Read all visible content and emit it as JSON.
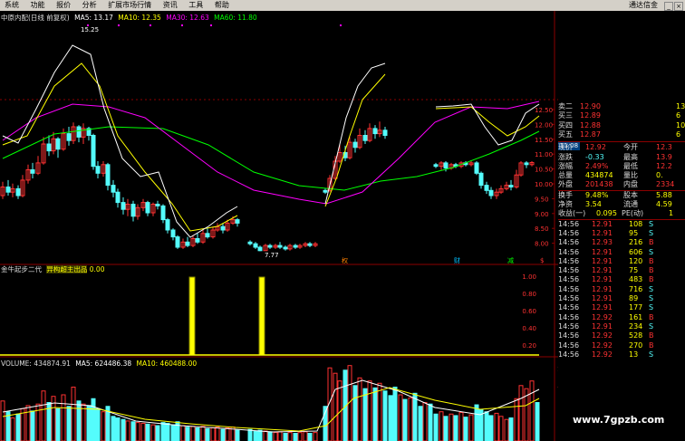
{
  "menu": {
    "items": [
      "系统",
      "功能",
      "报价",
      "分析",
      "扩展市场行情",
      "资讯",
      "工具",
      "帮助"
    ],
    "app_title": "通达信金"
  },
  "main_legend": {
    "stock": "中原内配(日线 前复权)",
    "ma5": "MA5: 13.17",
    "ma10": "MA10: 12.35",
    "ma30": "MA30: 12.63",
    "ma60": "MA60: 11.80"
  },
  "annotations": {
    "high_label": "15.25",
    "low_label": "7.77",
    "current_price_tag": "11.08"
  },
  "event_markers": [
    "权",
    "财",
    "减",
    "$"
  ],
  "price_axis": [
    "12.50",
    "12.00",
    "11.50",
    "11.00",
    "10.50",
    "10.00",
    "9.50",
    "9.00",
    "8.50",
    "8.00"
  ],
  "indicator": {
    "title": "金牛起步二代",
    "signal_label": "异构超主出品",
    "value": "0.00",
    "axis": [
      "1.00",
      "0.80",
      "0.60",
      "0.40",
      "0.20"
    ]
  },
  "volume": {
    "vol": "VOLUME: 434874.91",
    "ma5": "MA5: 624486.38",
    "ma10": "MA10: 460488.00",
    "axis": [
      "10000",
      "7500"
    ]
  },
  "quote_panel": {
    "asks": [
      {
        "label": "卖二",
        "price": "12.90",
        "vol": "13"
      },
      {
        "label": "买三",
        "price": "12.89",
        "vol": "6"
      },
      {
        "label": "买四",
        "price": "12.88",
        "vol": "10"
      },
      {
        "label": "买五",
        "price": "12.87",
        "vol": "6"
      }
    ],
    "stats": [
      {
        "l1": "现价",
        "v1": "12.92",
        "l2": "今开",
        "v2": "12.3"
      },
      {
        "l1": "涨跌",
        "v1": "-0.33",
        "l2": "最高",
        "v2": "13.9"
      },
      {
        "l1": "涨幅",
        "v1": "2.49%",
        "l2": "最低",
        "v2": "12.2"
      },
      {
        "l1": "总量",
        "v1": "434874",
        "l2": "量比",
        "v2": "0."
      },
      {
        "l1": "外盘",
        "v1": "201438",
        "l2": "内盘",
        "v2": "2334"
      },
      {
        "l1": "换手",
        "v1": "9.48%",
        "l2": "股本",
        "v2": "5.88"
      },
      {
        "l1": "净资",
        "v1": "3.54",
        "l2": "流通",
        "v2": "4.59"
      },
      {
        "l1": "收益(一)",
        "v1": "0.095",
        "l2": "PE(动)",
        "v2": "1"
      }
    ],
    "ticks": [
      {
        "t": "14:56",
        "p": "12.91",
        "v": "108",
        "s": "S"
      },
      {
        "t": "14:56",
        "p": "12.91",
        "v": "95",
        "s": "S"
      },
      {
        "t": "14:56",
        "p": "12.93",
        "v": "216",
        "s": "B"
      },
      {
        "t": "14:56",
        "p": "12.91",
        "v": "606",
        "s": "S"
      },
      {
        "t": "14:56",
        "p": "12.91",
        "v": "120",
        "s": "B"
      },
      {
        "t": "14:56",
        "p": "12.91",
        "v": "75",
        "s": "B"
      },
      {
        "t": "14:56",
        "p": "12.91",
        "v": "483",
        "s": "B"
      },
      {
        "t": "14:56",
        "p": "12.91",
        "v": "716",
        "s": "S"
      },
      {
        "t": "14:56",
        "p": "12.91",
        "v": "89",
        "s": "S"
      },
      {
        "t": "14:56",
        "p": "12.91",
        "v": "177",
        "s": "S"
      },
      {
        "t": "14:56",
        "p": "12.92",
        "v": "161",
        "s": "B"
      },
      {
        "t": "14:56",
        "p": "12.91",
        "v": "234",
        "s": "S"
      },
      {
        "t": "14:56",
        "p": "12.92",
        "v": "528",
        "s": "B"
      },
      {
        "t": "14:56",
        "p": "12.92",
        "v": "270",
        "s": "B"
      },
      {
        "t": "14:56",
        "p": "12.92",
        "v": "13",
        "s": "S"
      }
    ]
  },
  "watermark": "www.7gpzb.com",
  "colors": {
    "up": "#ff3232",
    "down": "#54fcfc",
    "ma5": "#ffffff",
    "ma10": "#ffff00",
    "ma30": "#ff00ff",
    "ma60": "#00ff00",
    "grid": "#8b0000",
    "signal": "#ffff00"
  }
}
